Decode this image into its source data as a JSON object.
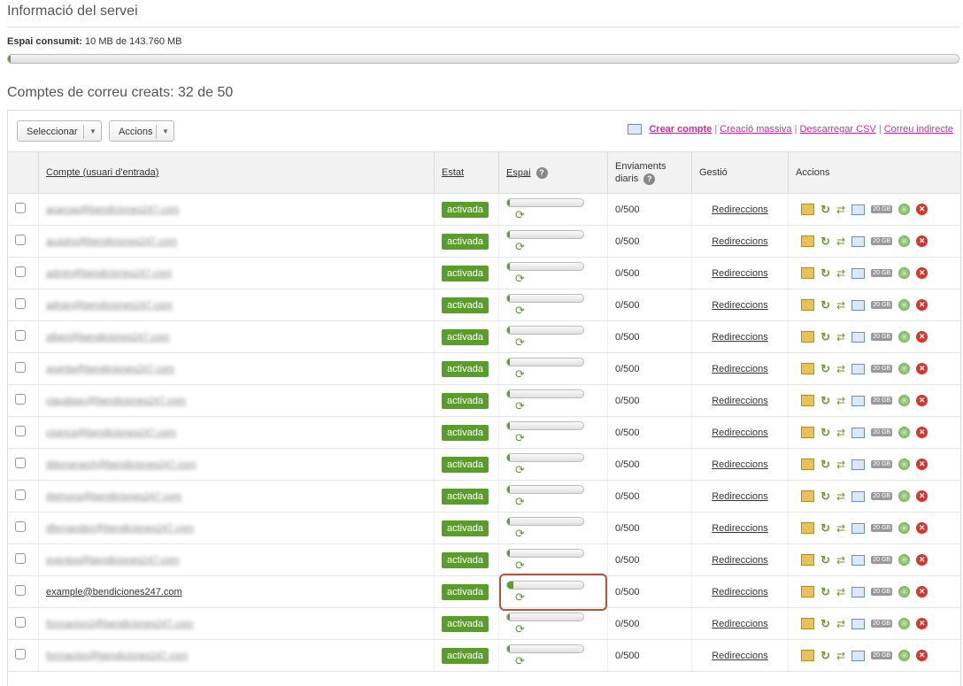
{
  "service": {
    "title": "Informació del servei",
    "usage_label": "Espai consumit:",
    "usage_value": "10 MB de 143.760 MB",
    "usage_fraction": 0.0001
  },
  "accounts": {
    "title": "Comptes de correu creats: 32 de 50",
    "toolbar": {
      "select_label": "Seleccionar",
      "actions_label": "Accions",
      "create_account": "Crear compte",
      "bulk_create": "Creació massiva",
      "download_csv": "Descarregar CSV",
      "indirect_mail": "Correu indirecte",
      "separator": "|"
    },
    "columns": {
      "account": "Compte (usuari d'entrada)",
      "status": "Estat",
      "space": "Espai",
      "daily_sends_line1": "Enviaments",
      "daily_sends_line2": "diaris",
      "management": "Gestió",
      "actions": "Accions",
      "help": "?"
    },
    "row_defaults": {
      "status": "activada",
      "sends": "0/500",
      "management": "Redireccions",
      "quota_badge": "20 GB",
      "delete_glyph": "✕"
    },
    "rows": [
      {
        "email": "acarcas@bendiciones247.com",
        "blurred": true,
        "used": 0.03
      },
      {
        "email": "acastro@bendiciones247.com",
        "blurred": true,
        "used": 0.03
      },
      {
        "email": "admin@bendiciones247.com",
        "blurred": true,
        "used": 0.03
      },
      {
        "email": "adrian@bendiciones247.com",
        "blurred": true,
        "used": 0.03
      },
      {
        "email": "albert@bendiciones247.com",
        "blurred": true,
        "used": 0.03
      },
      {
        "email": "asanta@bendiciones247.com",
        "blurred": true,
        "used": 0.03
      },
      {
        "email": "claudiasc@bendiciones247.com",
        "blurred": true,
        "used": 0.03
      },
      {
        "email": "csanca@bendiciones247.com",
        "blurred": true,
        "used": 0.03
      },
      {
        "email": "ddomenech@bendiciones247.com",
        "blurred": true,
        "used": 0.03
      },
      {
        "email": "dsimons@bendiciones247.com",
        "blurred": true,
        "used": 0.03
      },
      {
        "email": "dfernandez@bendiciones247.com",
        "blurred": true,
        "used": 0.03
      },
      {
        "email": "eventos@bendiciones247.com",
        "blurred": true,
        "used": 0.03
      },
      {
        "email": "example@bendiciones247.com",
        "blurred": false,
        "used": 0.08,
        "highlighted": true
      },
      {
        "email": "formacion2@bendiciones247.com",
        "blurred": true,
        "used": 0.03
      },
      {
        "email": "formacion@bendiciones247.com",
        "blurred": true,
        "used": 0.03
      }
    ]
  },
  "colors": {
    "accent_green": "#5a9e2a",
    "link_pink": "#c2339b",
    "highlight_border": "#b5543a"
  }
}
